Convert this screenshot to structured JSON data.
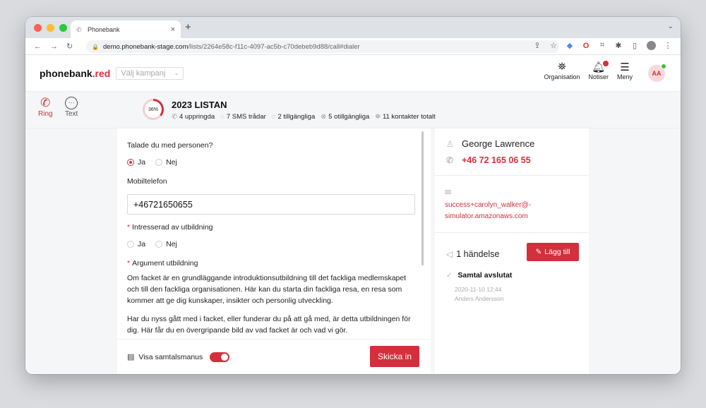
{
  "browser": {
    "tab_title": "Phonebank",
    "url_domain": "demo.phonebank-stage.com",
    "url_path": "/lists/2264e58c-f11c-4097-ac5b-c70debeb9d88/call#dialer"
  },
  "header": {
    "logo_main": "phonebank",
    "logo_accent": ".red",
    "campaign_placeholder": "Välj kampanj",
    "nav": [
      {
        "label": "Organisation"
      },
      {
        "label": "Notiser"
      },
      {
        "label": "Meny"
      }
    ],
    "avatar_initials": "AA"
  },
  "modes": {
    "ring": "Ring",
    "text": "Text"
  },
  "list": {
    "progress_label": "36%",
    "progress_fraction": 0.36,
    "title": "2023 LISTAN",
    "stats": [
      {
        "icon": "phone-icon",
        "text": "4 uppringda"
      },
      {
        "icon": "sms-icon",
        "text": "7 SMS trådar"
      },
      {
        "icon": "check-circle-icon",
        "text": "2 tillgängliga"
      },
      {
        "icon": "x-circle-icon",
        "text": "5 otillgängliga"
      },
      {
        "icon": "people-icon",
        "text": "11 kontakter totalt"
      }
    ]
  },
  "form": {
    "q1": "Talade du med personen?",
    "q1_yes": "Ja",
    "q1_no": "Nej",
    "mobile_label": "Mobiltelefon",
    "mobile_value": "+46721650655",
    "q2": "Intresserad av utbildning",
    "q2_yes": "Ja",
    "q2_no": "Nej",
    "q3": "Argument utbildning",
    "para1": "Om facket är en grundläggande introduktionsutbildning till det fackliga medlemskapet och till den fackliga organisationen. Här kan du starta din fackliga resa, en resa som kommer att ge dig kunskaper, insikter och personlig utveckling.",
    "para2": "Har du nyss gått med i facket, eller funderar du på att gå med, är detta utbildningen för dig. Här får du en övergripande bild av vad facket är och vad vi gör.",
    "script_toggle_label": "Visa samtalsmanus",
    "submit": "Skicka in"
  },
  "contact": {
    "name": "George Lawrence",
    "phone": "+46 72 165 06 55",
    "email": "success+carolyn_walker@-simulator.amazonaws.com"
  },
  "events": {
    "count_label": "1 händelse",
    "add_label": "Lägg till",
    "items": [
      {
        "title": "Samtal avslutat",
        "date": "2020-11-10 12:44",
        "by": "Anders Andersson"
      }
    ]
  },
  "colors": {
    "accent": "#d32f3c"
  }
}
